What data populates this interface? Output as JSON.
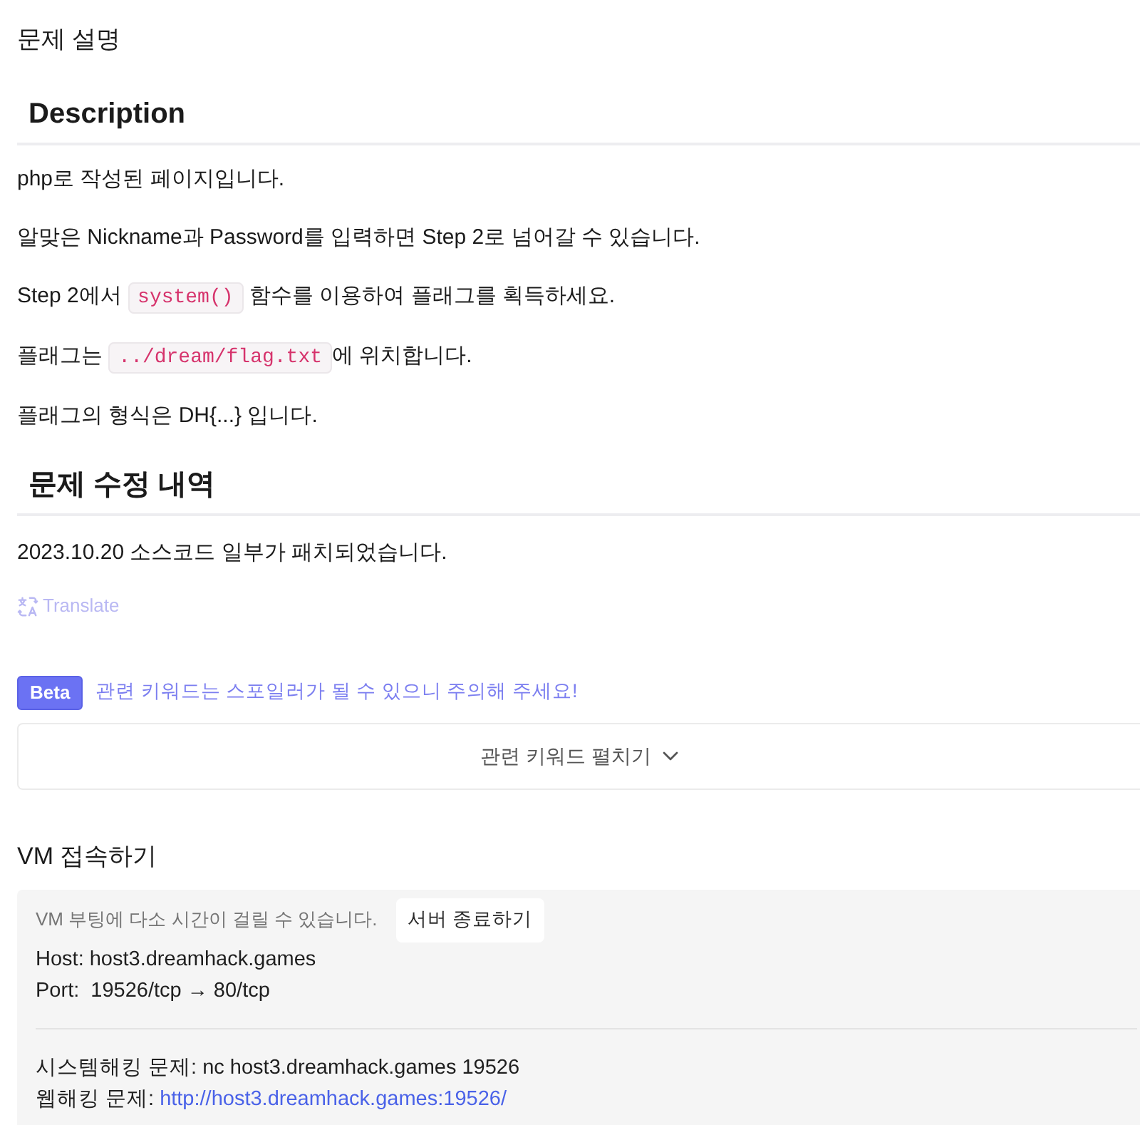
{
  "page": {
    "title": "문제 설명"
  },
  "description": {
    "heading": "Description",
    "paragraphs": [
      {
        "parts": [
          {
            "kind": "text",
            "text": "php로 작성된 페이지입니다."
          }
        ]
      },
      {
        "parts": [
          {
            "kind": "text",
            "text": "알맞은 Nickname과 Password를 입력하면 Step 2로 넘어갈 수 있습니다."
          }
        ]
      },
      {
        "parts": [
          {
            "kind": "text",
            "text": "Step 2에서 "
          },
          {
            "kind": "code",
            "text": "system()"
          },
          {
            "kind": "text",
            "text": " 함수를 이용하여 플래그를 획득하세요."
          }
        ]
      },
      {
        "parts": [
          {
            "kind": "text",
            "text": "플래그는 "
          },
          {
            "kind": "code",
            "text": "../dream/flag.txt"
          },
          {
            "kind": "text",
            "text": "에 위치합니다."
          }
        ]
      },
      {
        "parts": [
          {
            "kind": "text",
            "text": "플래그의 형식은 DH{...} 입니다."
          }
        ]
      }
    ]
  },
  "changelog": {
    "heading": "문제 수정 내역",
    "entries": [
      "2023.10.20 소스코드 일부가 패치되었습니다."
    ]
  },
  "translate": {
    "label": "Translate"
  },
  "keywords": {
    "badge": "Beta",
    "warning": "관련 키워드는 스포일러가 될 수 있으니 주의해 주세요!",
    "toggle": {
      "label": "관련 키워드 펼치기",
      "expanded": false
    }
  },
  "vm": {
    "title": "VM 접속하기",
    "notice": "VM 부팅에 다소 시간이 걸릴 수 있습니다.",
    "stop_button": "서버 종료하기",
    "host": "Host: host3.dreamhack.games",
    "port": "Port:  19526/tcp → 80/tcp",
    "system_hacking": "시스템해킹 문제: nc host3.dreamhack.games 19526",
    "web_hacking": {
      "label": "웹해킹 문제:",
      "link": "http://host3.dreamhack.games:19526/"
    }
  }
}
